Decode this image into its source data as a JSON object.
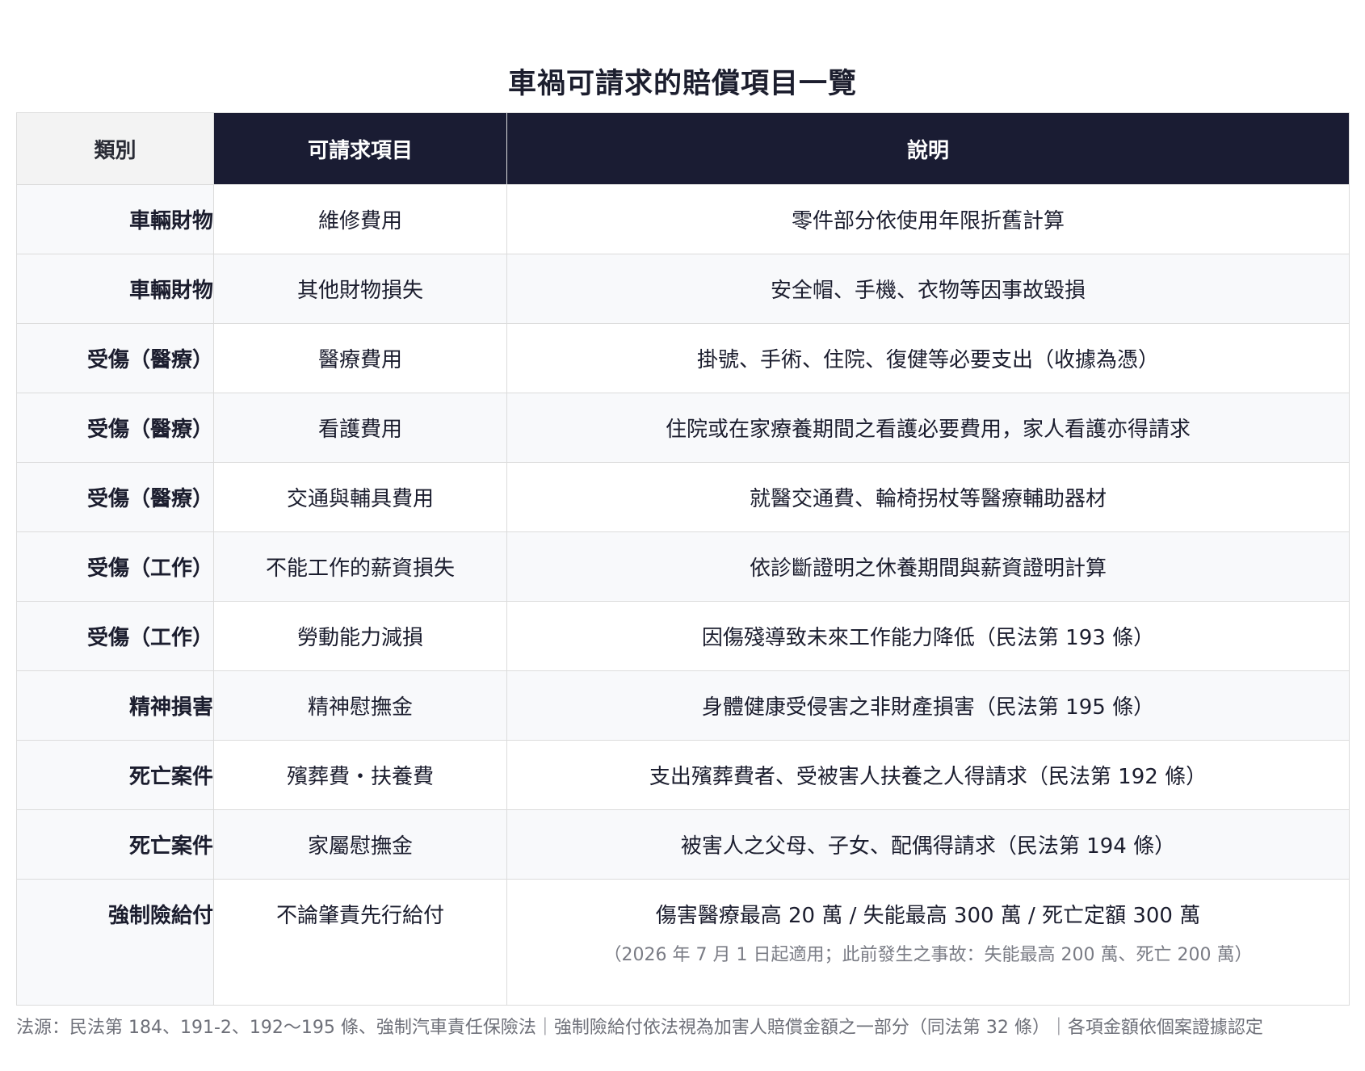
{
  "title": "車禍可請求的賠償項目一覽",
  "table": {
    "headers": {
      "category": "類別",
      "item": "可請求項目",
      "description": "說明"
    },
    "rows": [
      {
        "category": "車輛財物",
        "item": "維修費用",
        "description": "零件部分依使用年限折舊計算"
      },
      {
        "category": "車輛財物",
        "item": "其他財物損失",
        "description": "安全帽、手機、衣物等因事故毀損"
      },
      {
        "category": "受傷（醫療）",
        "item": "醫療費用",
        "description": "掛號、手術、住院、復健等必要支出（收據為憑）"
      },
      {
        "category": "受傷（醫療）",
        "item": "看護費用",
        "description": "住院或在家療養期間之看護必要費用，家人看護亦得請求"
      },
      {
        "category": "受傷（醫療）",
        "item": "交通與輔具費用",
        "description": "就醫交通費、輪椅拐杖等醫療輔助器材"
      },
      {
        "category": "受傷（工作）",
        "item": "不能工作的薪資損失",
        "description": "依診斷證明之休養期間與薪資證明計算"
      },
      {
        "category": "受傷（工作）",
        "item": "勞動能力減損",
        "description": "因傷殘導致未來工作能力降低（民法第 193 條）"
      },
      {
        "category": "精神損害",
        "item": "精神慰撫金",
        "description": "身體健康受侵害之非財產損害（民法第 195 條）"
      },
      {
        "category": "死亡案件",
        "item": "殯葬費・扶養費",
        "description": "支出殯葬費者、受被害人扶養之人得請求（民法第 192 條）"
      },
      {
        "category": "死亡案件",
        "item": "家屬慰撫金",
        "description": "被害人之父母、子女、配偶得請求（民法第 194 條）"
      },
      {
        "category": "強制險給付",
        "item": "不論肇責先行給付",
        "description": "傷害醫療最高 20 萬 / 失能最高 300 萬 / 死亡定額 300 萬",
        "note": "（2026 年 7 月 1 日起適用；此前發生之事故：失能最高 200 萬、死亡 200 萬）"
      }
    ]
  },
  "footer": "法源：民法第 184、191-2、192～195 條、強制汽車責任保險法｜強制險給付依法視為加害人賠償金額之一部分（同法第 32 條）｜各項金額依個案證據認定"
}
